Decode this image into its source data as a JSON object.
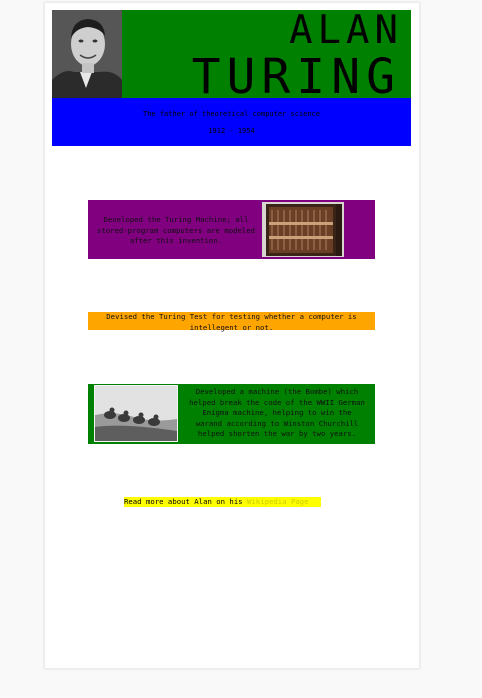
{
  "header": {
    "first_name": "ALAN",
    "last_name": "TURING",
    "subtitle": "The father of theoretical computer science",
    "years": "1912 - 1954"
  },
  "facts": [
    {
      "text": "Developed the Turing Machine; all stored-program computers are modeled after this invention."
    },
    {
      "text": "Devised the Turing Test for testing whether a computer is intellegent or not."
    },
    {
      "text": "Developed a machine (the Bombe) which helped break the code of the WWII German Enigma machine, helping to win the warand according to Winston Churchill helped shorten the war by two years."
    }
  ],
  "footer": {
    "prefix": "Read more about Alan on his ",
    "link_label": "Wikipedia Page"
  },
  "colors": {
    "header_green": "#008000",
    "header_blue": "#0000ff",
    "card_purple": "#800080",
    "card_orange": "#ffa500",
    "card_green": "#008000",
    "footer_yellow": "#ffff00"
  },
  "icons": [
    "portrait-photo",
    "machine-photo",
    "soldiers-photo"
  ]
}
